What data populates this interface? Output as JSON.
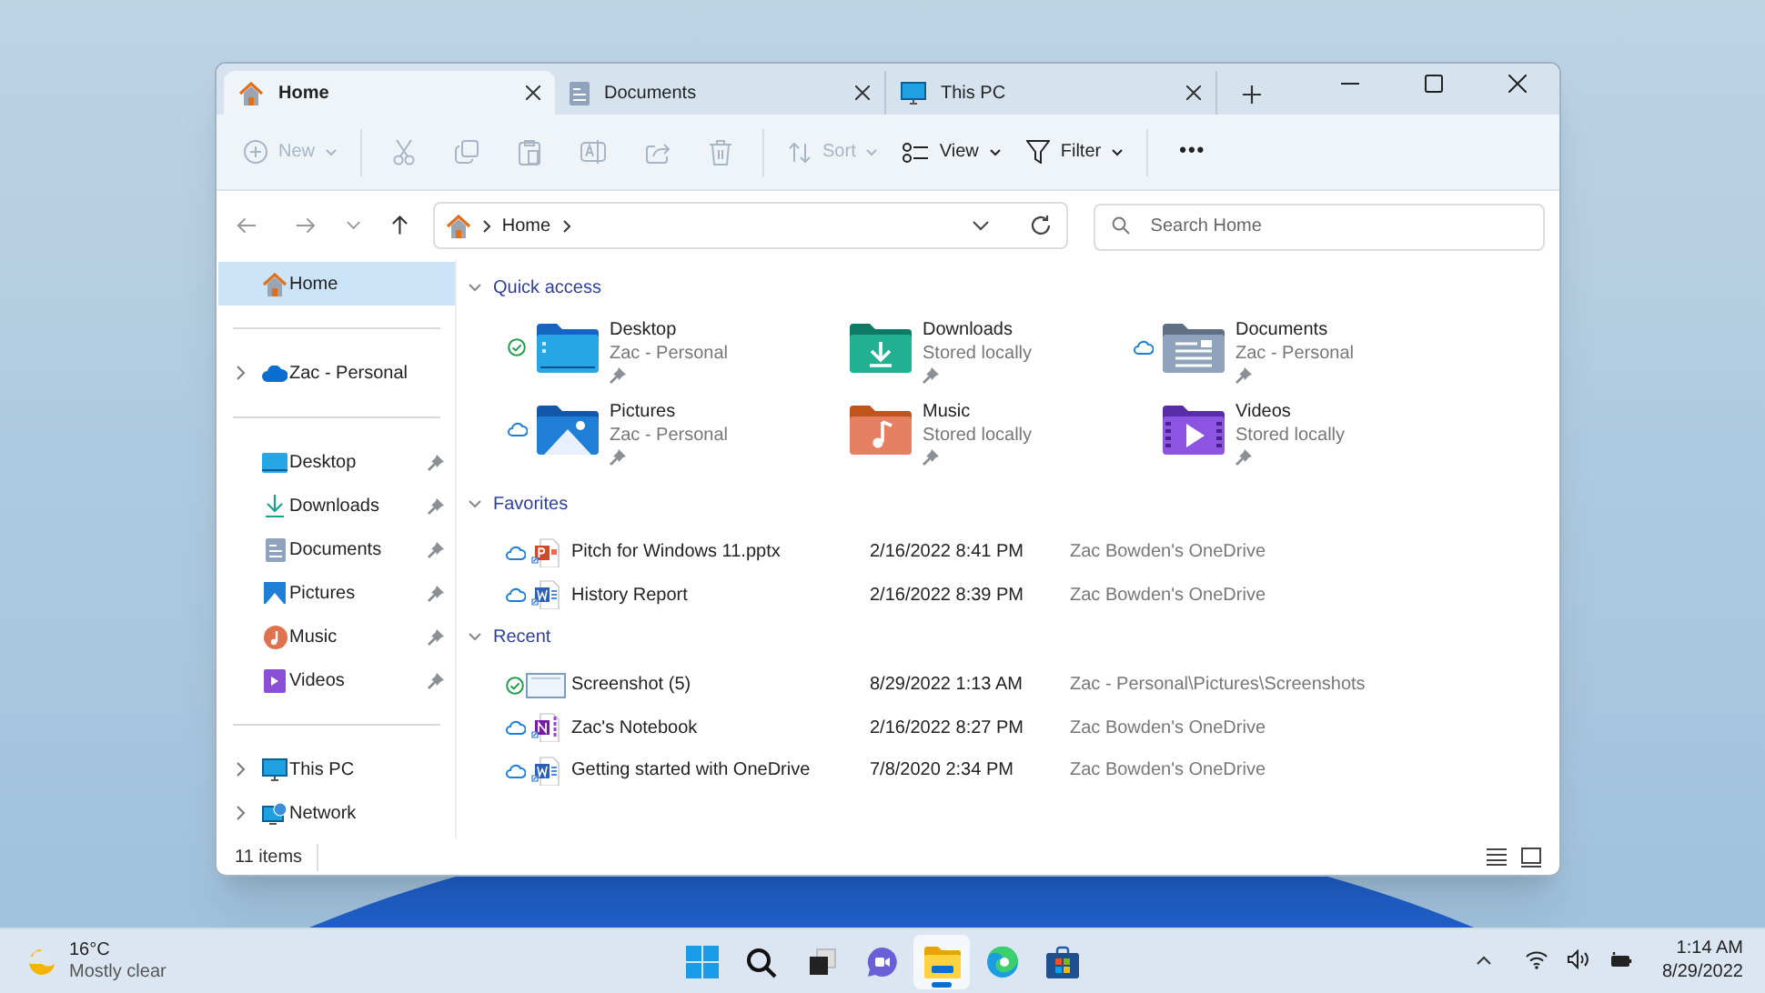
{
  "tabs": [
    {
      "label": "Home",
      "kind": "home",
      "selected": true
    },
    {
      "label": "Documents",
      "kind": "documents",
      "selected": false
    },
    {
      "label": "This PC",
      "kind": "pc",
      "selected": false
    }
  ],
  "toolbar_groups": [
    {
      "items": [
        {
          "kind": "new",
          "label": "New",
          "disabled": true
        }
      ]
    },
    {
      "items": [
        {
          "kind": "cut",
          "disabled": true
        },
        {
          "kind": "copy",
          "disabled": true
        },
        {
          "kind": "paste",
          "disabled": true
        },
        {
          "kind": "rename",
          "disabled": true
        },
        {
          "kind": "share",
          "disabled": true
        },
        {
          "kind": "delete",
          "disabled": true
        }
      ]
    },
    {
      "items": [
        {
          "kind": "sort",
          "label": "Sort",
          "disabled": true
        },
        {
          "kind": "view",
          "label": "View",
          "disabled": false
        },
        {
          "kind": "filter",
          "label": "Filter",
          "disabled": false
        }
      ]
    },
    {
      "items": [
        {
          "kind": "more",
          "label": "•••",
          "disabled": false
        }
      ]
    }
  ],
  "address": {
    "path": [
      "Home"
    ],
    "search_placeholder": "Search Home"
  },
  "sidebar": [
    {
      "items": [
        {
          "label": "Home",
          "kind": "home",
          "selected": true,
          "expandable": false,
          "pinned": false
        }
      ]
    },
    {
      "items": [
        {
          "label": "Zac - Personal",
          "kind": "cloud",
          "selected": false,
          "expandable": true,
          "pinned": false
        }
      ]
    },
    {
      "items": [
        {
          "label": "Desktop",
          "kind": "desktop",
          "selected": false,
          "expandable": false,
          "pinned": true
        },
        {
          "label": "Downloads",
          "kind": "downloads",
          "selected": false,
          "expandable": false,
          "pinned": true
        },
        {
          "label": "Documents",
          "kind": "documents",
          "selected": false,
          "expandable": false,
          "pinned": true
        },
        {
          "label": "Pictures",
          "kind": "pictures",
          "selected": false,
          "expandable": false,
          "pinned": true
        },
        {
          "label": "Music",
          "kind": "music",
          "selected": false,
          "expandable": false,
          "pinned": true
        },
        {
          "label": "Videos",
          "kind": "videos",
          "selected": false,
          "expandable": false,
          "pinned": true
        }
      ]
    },
    {
      "items": [
        {
          "label": "This PC",
          "kind": "pc",
          "selected": false,
          "expandable": true,
          "pinned": false
        },
        {
          "label": "Network",
          "kind": "network",
          "selected": false,
          "expandable": true,
          "pinned": false
        }
      ]
    }
  ],
  "quick_access": {
    "title": "Quick access",
    "expanded": true,
    "items": [
      {
        "name": "Desktop",
        "location": "Zac - Personal",
        "kind": "desktop",
        "synced": true,
        "online_only": false,
        "pinned": true
      },
      {
        "name": "Downloads",
        "location": "Stored locally",
        "kind": "downloads",
        "synced": false,
        "online_only": false,
        "pinned": true
      },
      {
        "name": "Documents",
        "location": "Zac - Personal",
        "kind": "documents",
        "synced": false,
        "online_only": true,
        "pinned": true
      },
      {
        "name": "Pictures",
        "location": "Zac - Personal",
        "kind": "pictures",
        "synced": false,
        "online_only": true,
        "pinned": true
      },
      {
        "name": "Music",
        "location": "Stored locally",
        "kind": "music",
        "synced": false,
        "online_only": false,
        "pinned": true
      },
      {
        "name": "Videos",
        "location": "Stored locally",
        "kind": "videos",
        "synced": false,
        "online_only": false,
        "pinned": true
      }
    ]
  },
  "file_sections": [
    {
      "title": "Favorites",
      "expanded": true,
      "rows": [
        {
          "name": "Pitch for Windows 11.pptx",
          "date": "2/16/2022 8:41 PM",
          "location": "Zac Bowden's OneDrive",
          "kind": "pptx",
          "synced": false,
          "online_only": true
        },
        {
          "name": "History Report",
          "date": "2/16/2022 8:39 PM",
          "location": "Zac Bowden's OneDrive",
          "kind": "docx",
          "synced": false,
          "online_only": true
        }
      ]
    },
    {
      "title": "Recent",
      "expanded": true,
      "rows": [
        {
          "name": "Screenshot (5)",
          "date": "8/29/2022 1:13 AM",
          "location": "Zac - Personal\\Pictures\\Screenshots",
          "kind": "image",
          "synced": true,
          "online_only": false
        },
        {
          "name": "Zac's Notebook",
          "date": "2/16/2022 8:27 PM",
          "location": "Zac Bowden's OneDrive",
          "kind": "onenote",
          "synced": false,
          "online_only": true
        },
        {
          "name": "Getting started with OneDrive",
          "date": "7/8/2020 2:34 PM",
          "location": "Zac Bowden's OneDrive",
          "kind": "docx",
          "synced": false,
          "online_only": true
        }
      ]
    }
  ],
  "status_bar": {
    "count": "11 items"
  },
  "taskbar": {
    "weather": {
      "temperature": "16°C",
      "condition": "Mostly clear"
    },
    "apps": [
      {
        "kind": "start",
        "selected": false
      },
      {
        "kind": "search",
        "selected": false
      },
      {
        "kind": "taskview",
        "selected": false
      },
      {
        "kind": "chat",
        "selected": false
      },
      {
        "kind": "explorer",
        "selected": true
      },
      {
        "kind": "edge",
        "selected": false
      },
      {
        "kind": "store",
        "selected": false
      }
    ],
    "time": "1:14 AM",
    "date": "8/29/2022"
  }
}
